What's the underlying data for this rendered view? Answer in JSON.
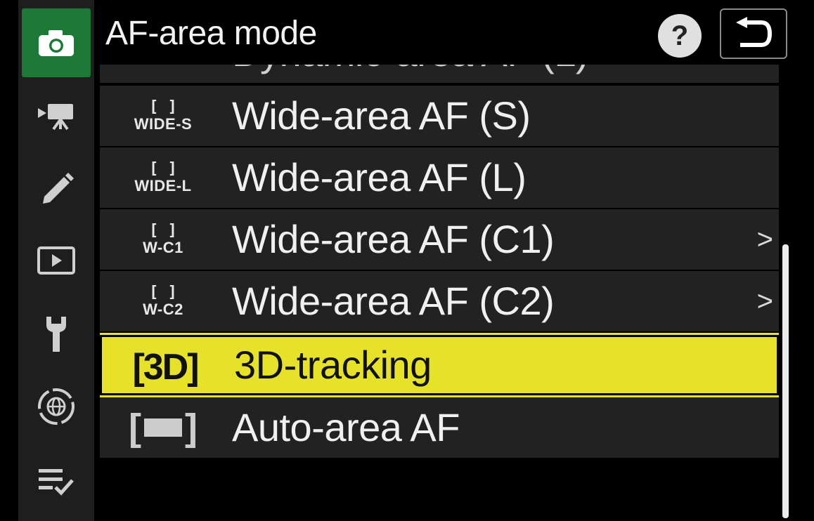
{
  "header": {
    "title": "AF-area mode",
    "help_label": "?",
    "back_icon": "return-arrow-icon"
  },
  "tabs": [
    {
      "name": "photo-shooting",
      "icon": "camera-icon",
      "active": true
    },
    {
      "name": "movie-recording",
      "icon": "movie-camera-icon",
      "active": false
    },
    {
      "name": "custom-settings",
      "icon": "pencil-icon",
      "active": false
    },
    {
      "name": "playback",
      "icon": "playback-icon",
      "active": false
    },
    {
      "name": "setup",
      "icon": "wrench-icon",
      "active": false
    },
    {
      "name": "network",
      "icon": "network-globe-icon",
      "active": false
    },
    {
      "name": "my-menu",
      "icon": "my-menu-icon",
      "active": false
    }
  ],
  "list": {
    "partial_label": "Dynamic-area AF (L)",
    "items": [
      {
        "icon_top": "[ ]",
        "icon_text": "WIDE-S",
        "label": "Wide-area AF (S)",
        "chevron": ""
      },
      {
        "icon_top": "[ ]",
        "icon_text": "WIDE-L",
        "label": "Wide-area AF (L)",
        "chevron": ""
      },
      {
        "icon_top": "[ ]",
        "icon_text": "W-C1",
        "label": "Wide-area AF (C1)",
        "chevron": ">"
      },
      {
        "icon_top": "[ ]",
        "icon_text": "W-C2",
        "label": "Wide-area AF (C2)",
        "chevron": ">"
      },
      {
        "icon_text": "[3D]",
        "label": "3D-tracking",
        "chevron": "",
        "selected": true
      },
      {
        "icon_text": "",
        "label": "Auto-area AF",
        "chevron": ""
      }
    ]
  },
  "colors": {
    "selected_bg": "#e6e22a",
    "active_tab": "#1c7a36",
    "row_bg": "#222222"
  }
}
